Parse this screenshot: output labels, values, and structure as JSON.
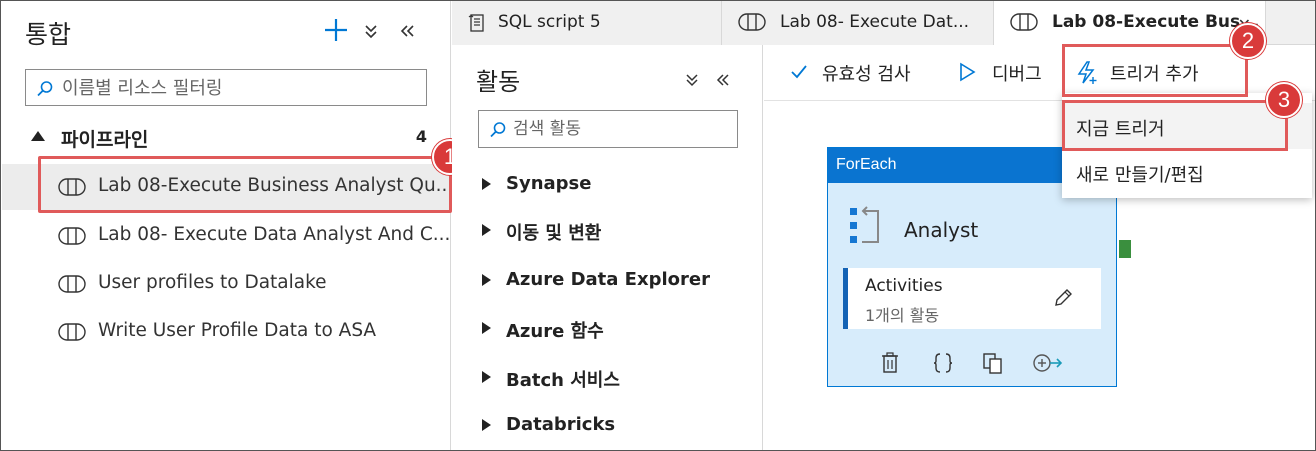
{
  "integrate": {
    "title": "통합",
    "search_placeholder": "이름별 리소스 필터링",
    "section_label": "파이프라인",
    "section_count": "4",
    "pipelines": [
      {
        "label": "Lab 08-Execute Business Analyst Qu..."
      },
      {
        "label": "Lab 08- Execute Data Analyst And C..."
      },
      {
        "label": "User profiles to Datalake"
      },
      {
        "label": "Write User Profile Data to ASA"
      }
    ]
  },
  "tabs": [
    {
      "label": "SQL script 5",
      "icon": "sql-script-icon"
    },
    {
      "label": "Lab 08- Execute Dat...",
      "icon": "pipeline-icon"
    },
    {
      "label": "Lab 08-Execute Bus...",
      "icon": "pipeline-icon"
    }
  ],
  "activities": {
    "title": "활동",
    "search_placeholder": "검색 활동",
    "categories": [
      "Synapse",
      "이동 및 변환",
      "Azure Data Explorer",
      "Azure 함수",
      "Batch 서비스",
      "Databricks"
    ]
  },
  "toolbar": {
    "validate": "유효성 검사",
    "debug": "디버그",
    "add_trigger": "트리거 추가"
  },
  "trigger_menu": {
    "trigger_now": "지금 트리거",
    "new_edit": "새로 만들기/편집"
  },
  "foreach": {
    "header": "ForEach",
    "name": "Analyst",
    "activities_label": "Activities",
    "activities_count": "1개의 활동"
  },
  "badges": {
    "b1": "1",
    "b2": "2",
    "b3": "3"
  },
  "colors": {
    "accent": "#0078d4",
    "highlight": "#e05a5a",
    "badge": "#d93a3a"
  }
}
